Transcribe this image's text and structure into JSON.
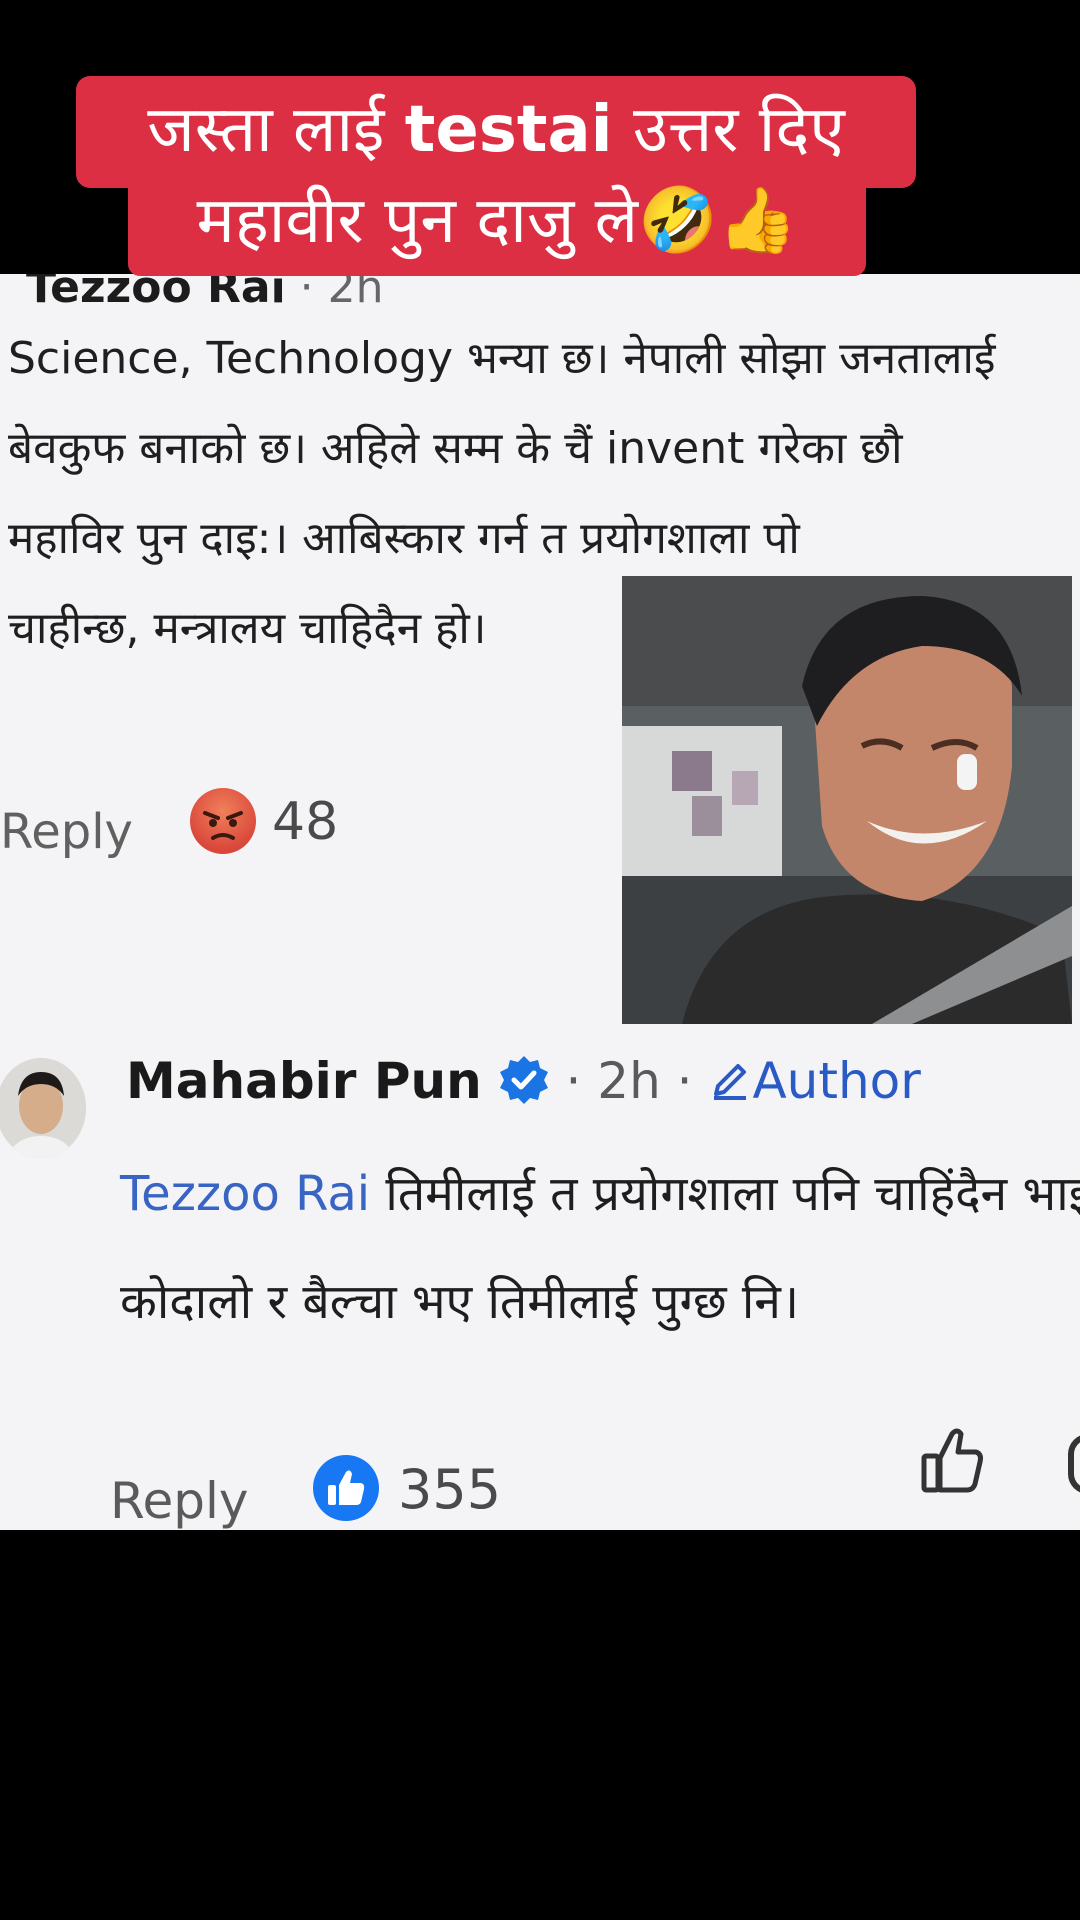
{
  "caption": {
    "line1_part1": "जस्ता लाई ",
    "line1_latin": "testai",
    "line1_part2": " उत्तर दिए",
    "line2": "महावीर पुन दाजु ले🤣👍"
  },
  "comment1": {
    "author": "Tezzoo Rai",
    "time": " · 2h",
    "lines": [
      "Science, Technology भन्या छ। नेपाली सोझा जनतालाई",
      "बेवकुफ बनाको छ। अहिले सम्म के चैं invent गरेका छौ",
      "महाविर पुन दाइ:।  आबिस्कार गर्न त प्रयोगशाला पो",
      "चाहीन्छ, मन्त्रालय चाहिदैन हो।"
    ],
    "reply_label": "Reply",
    "reaction_icon": "angry-reaction-icon",
    "reaction_count": "48"
  },
  "comment2": {
    "author": "Mahabir Pun",
    "time": " · 2h · ",
    "author_badge": "Author",
    "mention": "Tezzoo Rai",
    "line1_rest": " तिमीलाई त प्रयोगशाला पनि चाहिंदैन भाई",
    "line2": "कोदालो र बैल्चा भए तिमीलाई पुग्छ नि।",
    "reply_label": "Reply",
    "reaction_icon": "like-reaction-icon",
    "reaction_count": "355"
  },
  "colors": {
    "caption_bg": "#dc2f44",
    "link_blue": "#3864c4",
    "like_blue": "#1877f2",
    "angry_orange": "#e8603a"
  }
}
